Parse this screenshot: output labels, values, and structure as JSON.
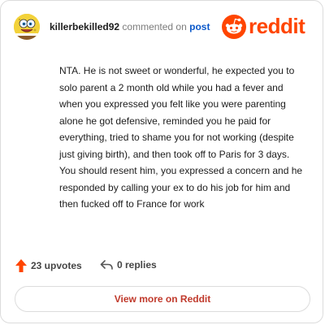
{
  "header": {
    "username": "killerbekilled92",
    "commented_text": "commented on",
    "post_link": "post",
    "logo_text": "reddit"
  },
  "comment": {
    "body": "NTA. He is not sweet or wonderful, he expected you to solo parent a 2 month old while you had a fever and when you expressed you felt like you were parenting alone he got defensive, reminded you he paid for everything, tried to shame you for not working (despite just giving birth), and then took off to Paris for 3 days. You should resent him, you expressed a concern and he responded by calling your ex to do his job for him and then fucked off to France for work"
  },
  "actions": {
    "upvotes_label": "23 upvotes",
    "replies_label": "0 replies"
  },
  "footer": {
    "view_more_label": "View more on Reddit"
  },
  "colors": {
    "brand": "#ff4500",
    "link": "#0a58ca",
    "button_text": "#c0392b",
    "avatar_bg": "#f1cc2c"
  },
  "icons": [
    "avatar-spongebob",
    "reddit-snoo-icon",
    "upvote-arrow-icon",
    "reply-arrow-icon"
  ]
}
